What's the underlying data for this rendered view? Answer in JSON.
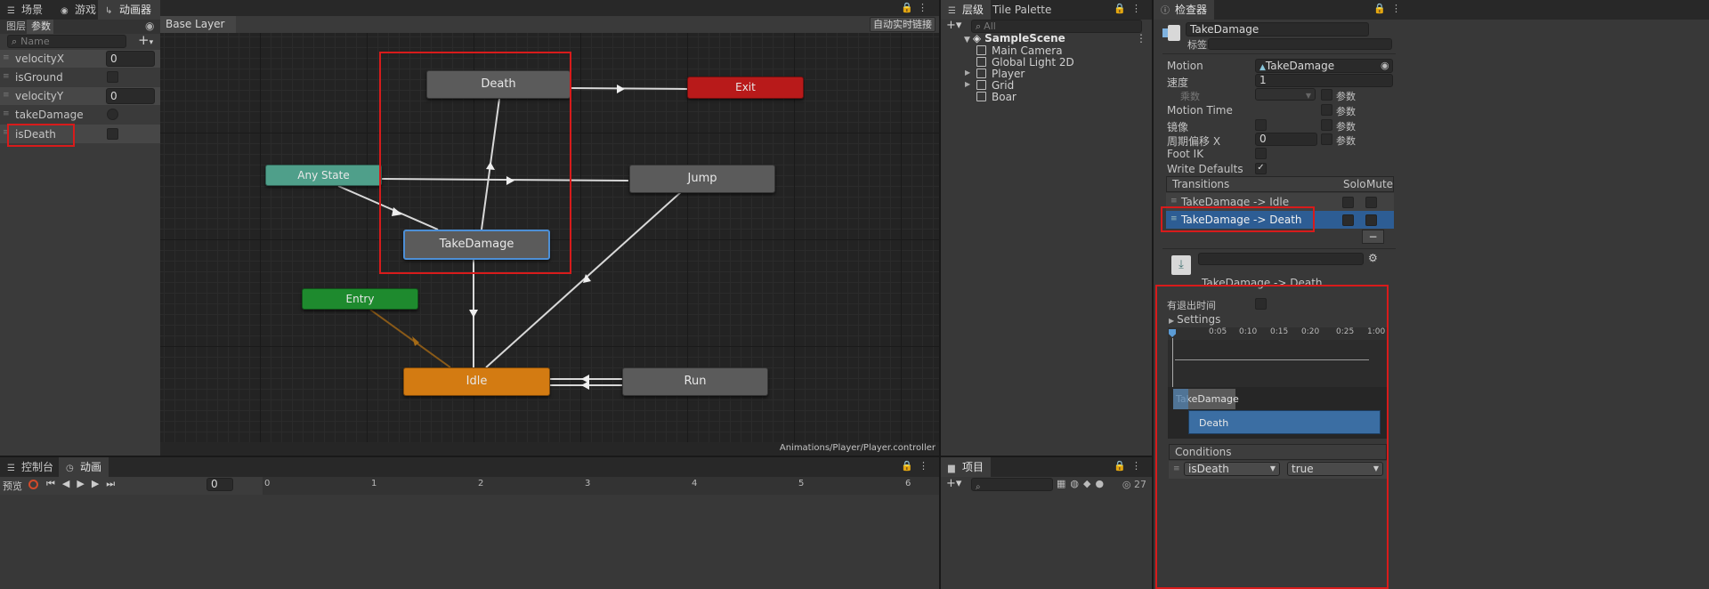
{
  "left_panel": {
    "tabs": [
      {
        "label": "场景"
      },
      {
        "label": "游戏"
      },
      {
        "label": "动画器"
      }
    ],
    "subtabs": [
      {
        "label": "图层"
      },
      {
        "label": "参数"
      }
    ],
    "search_placeholder": "Name",
    "parameters": [
      {
        "name": "velocityX",
        "type": "float",
        "value": "0"
      },
      {
        "name": "isGround",
        "type": "bool",
        "value": ""
      },
      {
        "name": "velocityY",
        "type": "float",
        "value": "0"
      },
      {
        "name": "takeDamage",
        "type": "trigger",
        "value": ""
      },
      {
        "name": "isDeath",
        "type": "bool",
        "value": ""
      }
    ]
  },
  "graph": {
    "layer_name": "Base Layer",
    "live_link_label": "自动实时链接",
    "footer_path": "Animations/Player/Player.controller",
    "states": {
      "death": "Death",
      "exit": "Exit",
      "any_state": "Any State",
      "jump": "Jump",
      "take_damage": "TakeDamage",
      "entry": "Entry",
      "idle": "Idle",
      "run": "Run"
    },
    "colors": {
      "exit": "#b81a1a",
      "any_state": "#4f9f8a",
      "entry": "#1e8a2e",
      "idle": "#d37b12",
      "default": "#5a5a5a"
    }
  },
  "hierarchy": {
    "tabs": [
      {
        "label": "层级"
      },
      {
        "label": "Tile Palette"
      }
    ],
    "search_placeholder": "All",
    "scene": "SampleScene",
    "items": [
      "Main Camera",
      "Global Light 2D",
      "Player",
      "Grid",
      "Boar"
    ]
  },
  "project": {
    "tab": "项目",
    "count": "27"
  },
  "inspector": {
    "tab": "检查器",
    "name": "TakeDamage",
    "tag_label": "标签",
    "motion_label": "Motion",
    "motion_value": "TakeDamage",
    "speed_label": "速度",
    "speed_value": "1",
    "multiplier_label": "乘数",
    "param_label": "参数",
    "motion_time_label": "Motion Time",
    "mirror_label": "镜像",
    "cycle_offset_label": "周期偏移 X",
    "cycle_offset_value": "0",
    "foot_ik_label": "Foot IK",
    "write_defaults_label": "Write Defaults",
    "transitions_header": "Transitions",
    "solo_label": "Solo",
    "mute_label": "Mute",
    "transitions": [
      "TakeDamage -> Idle",
      "TakeDamage -> Death"
    ],
    "minus_label": "−",
    "transition_title": "TakeDamage -> Death",
    "has_exit_time_label": "有退出时间",
    "settings_label": "Settings",
    "timeline_ticks": [
      "0:05",
      "0:10",
      "0:15",
      "0:20",
      "0:25",
      "1:00"
    ],
    "clip_from": "TakeDamage",
    "clip_to": "Death",
    "conditions_label": "Conditions",
    "condition_param": "isDeath",
    "condition_value": "true"
  },
  "bottom": {
    "tabs": [
      {
        "label": "控制台"
      },
      {
        "label": "动画"
      }
    ],
    "preview_label": "预览",
    "frame_value": "0",
    "ruler": [
      "0",
      "1",
      "2",
      "3",
      "4",
      "5",
      "6"
    ]
  }
}
